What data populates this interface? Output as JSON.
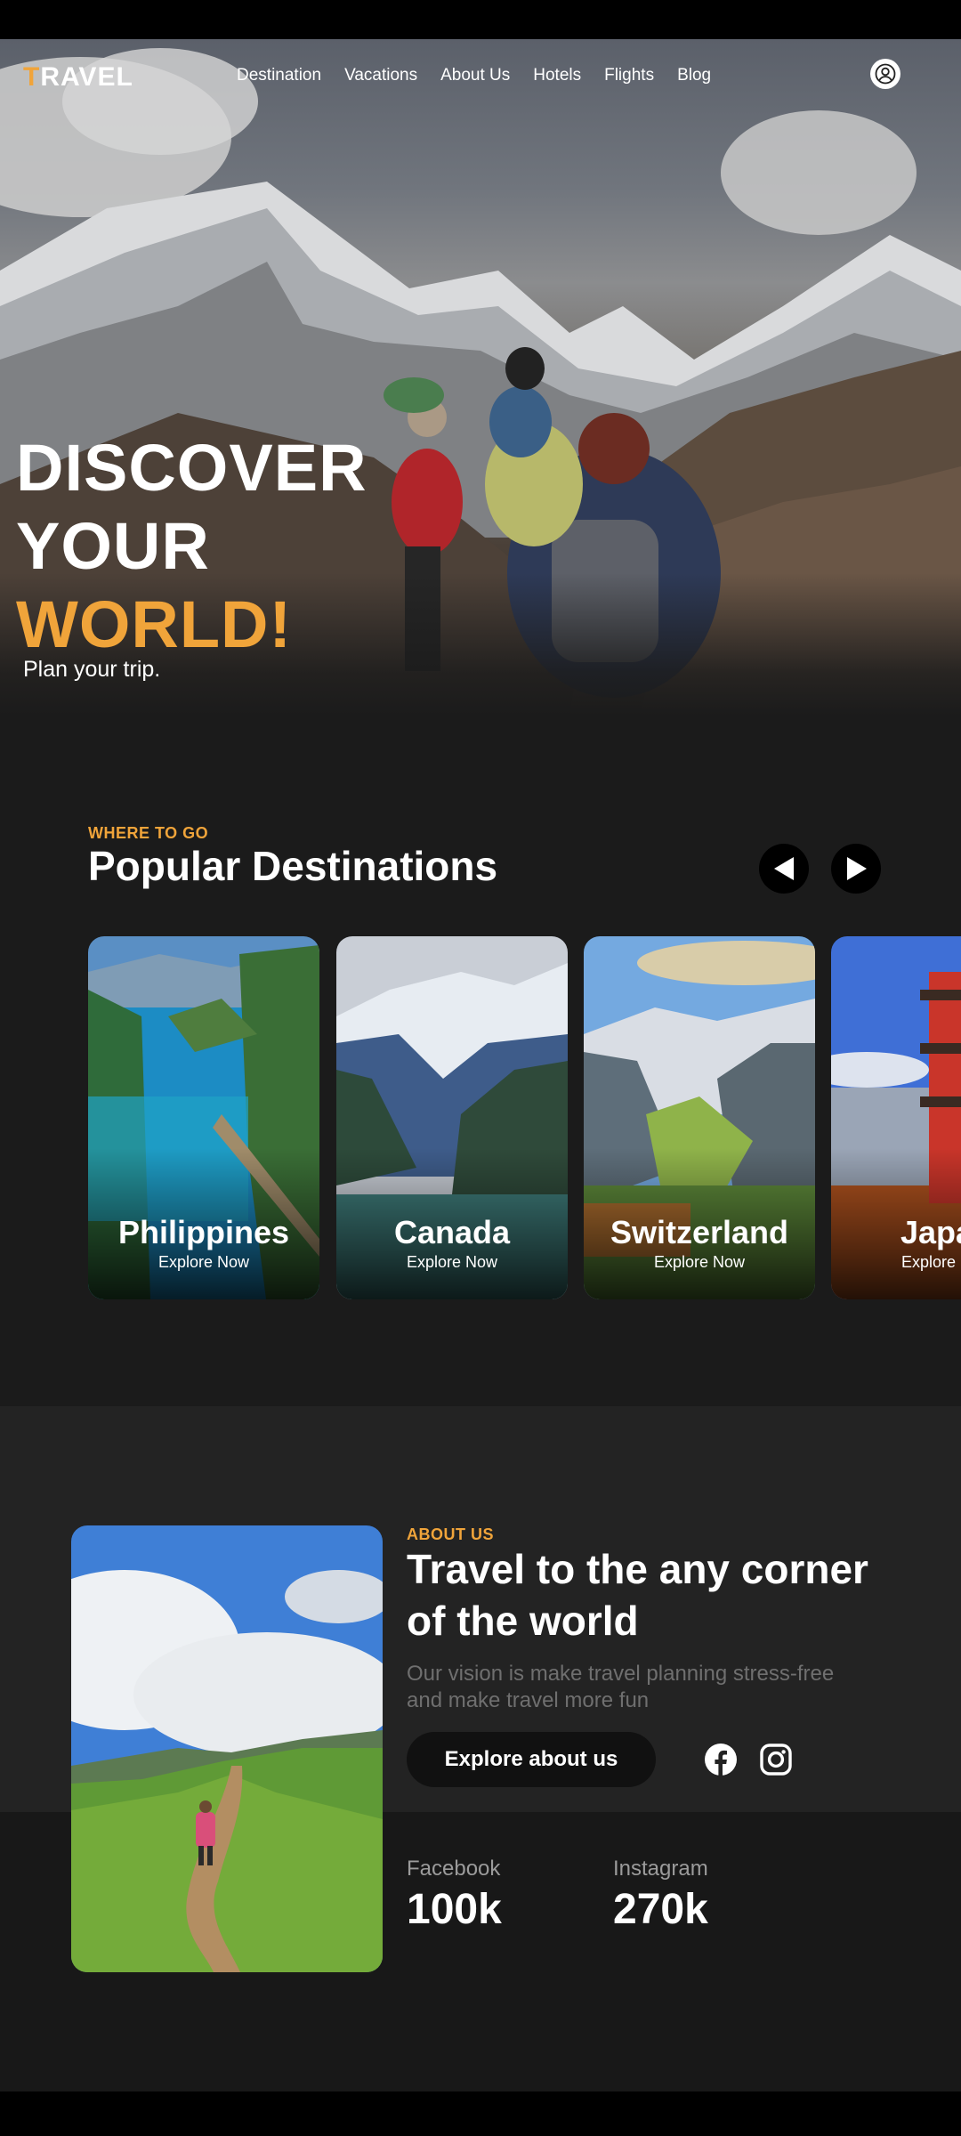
{
  "header": {
    "logo_first": "T",
    "logo_rest": "RAVEL",
    "nav": [
      "Destination",
      "Vacations",
      "About Us",
      "Hotels",
      "Flights",
      "Blog"
    ],
    "user_icon": "user-circle-icon"
  },
  "hero": {
    "line1": "DISCOVER",
    "line2": "YOUR",
    "line3": "WORLD!",
    "subtitle": "Plan your trip."
  },
  "popular": {
    "eyebrow": "WHERE TO GO",
    "title": "Popular Destinations",
    "prev_icon": "arrow-left-icon",
    "next_icon": "arrow-right-icon",
    "cards": [
      {
        "name": "Philippines",
        "cta": "Explore Now"
      },
      {
        "name": "Canada",
        "cta": "Explore Now"
      },
      {
        "name": "Switzerland",
        "cta": "Explore Now"
      },
      {
        "name": "Japan",
        "cta": "Explore Now"
      }
    ]
  },
  "about": {
    "eyebrow": "ABOUT US",
    "title": "Travel to the any corner of the world",
    "description": "Our vision is make travel planning stress-free and make travel more fun",
    "button": "Explore about us",
    "social_icons": [
      "facebook-icon",
      "instagram-icon"
    ]
  },
  "stats": [
    {
      "label": "Facebook",
      "value": "100k"
    },
    {
      "label": "Instagram",
      "value": "270k"
    }
  ],
  "colors": {
    "accent": "#f0a43a",
    "background": "#1b1b1b",
    "panel": "#232323"
  }
}
